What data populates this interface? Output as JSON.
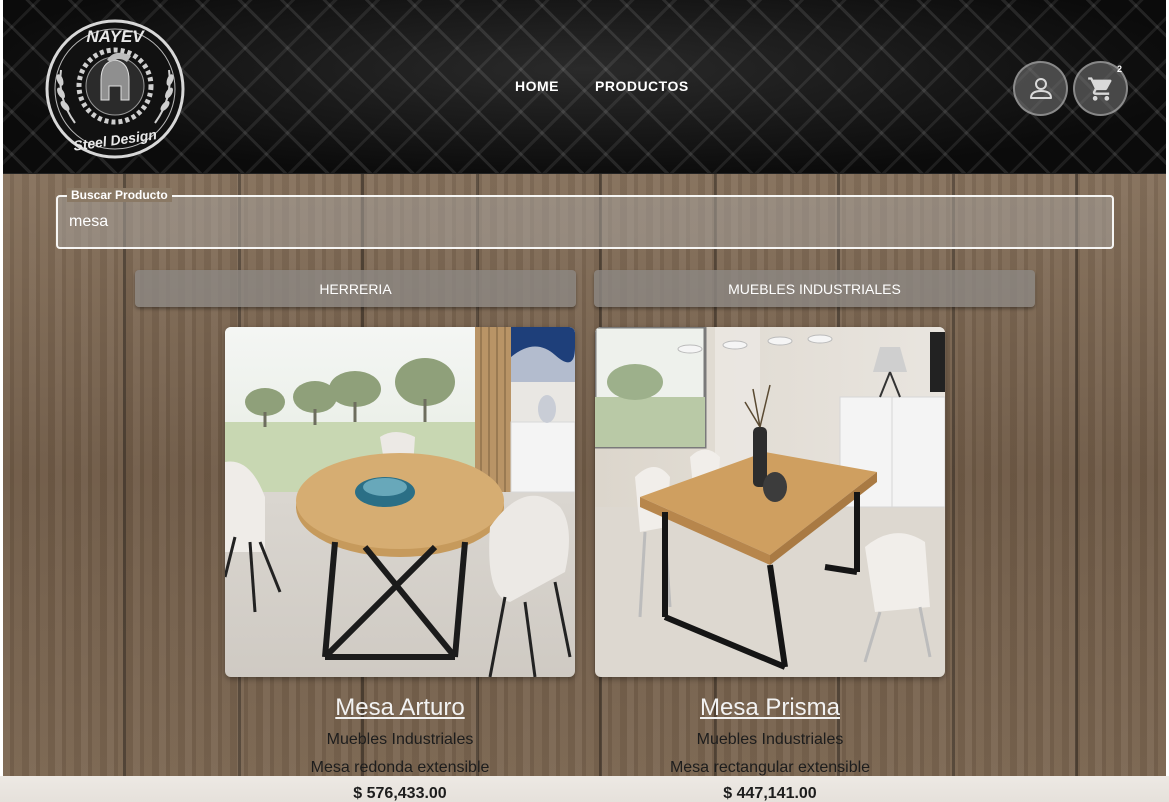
{
  "header": {
    "logo": {
      "brand": "NAYEV",
      "tagline": "Steel Design"
    },
    "nav": [
      {
        "label": "HOME"
      },
      {
        "label": "PRODUCTOS"
      }
    ],
    "user_icon": "user-icon",
    "cart_icon": "shopping-cart-icon",
    "cart_count": "2"
  },
  "search": {
    "label": "Buscar Producto",
    "value": "mesa"
  },
  "categories": [
    {
      "label": "HERRERIA"
    },
    {
      "label": "MUEBLES INDUSTRIALES"
    }
  ],
  "products": [
    {
      "name": "Mesa Arturo",
      "category": "Muebles Industriales",
      "description": "Mesa redonda extensible",
      "price": "$ 576,433.00"
    },
    {
      "name": "Mesa Prisma",
      "category": "Muebles Industriales",
      "description": "Mesa rectangular extensible",
      "price": "$ 447,141.00"
    }
  ],
  "colors": {
    "header_bg": "#0d0d0d",
    "wood": "#7a6551",
    "button_bg": "#8c8782",
    "text_white": "#ffffff",
    "text_dark": "#1d1d1d"
  }
}
